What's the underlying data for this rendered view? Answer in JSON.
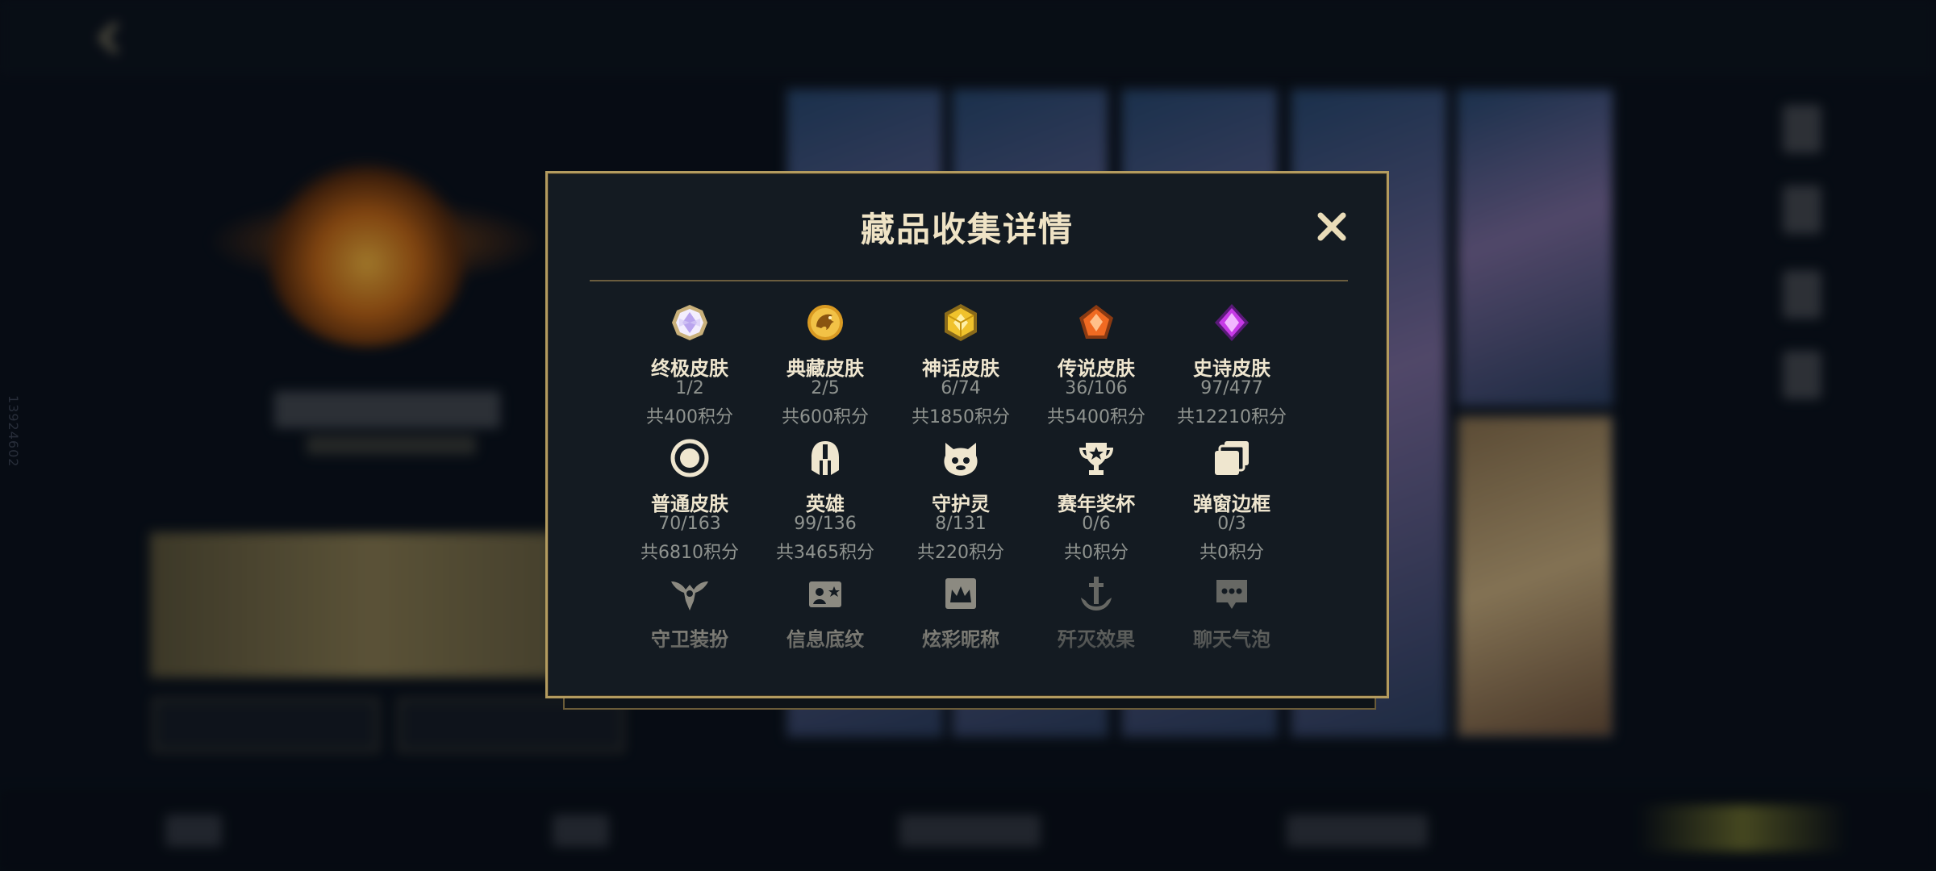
{
  "background": {
    "back_label": "",
    "vertical_id": "13924602"
  },
  "modal": {
    "title": "藏品收集详情",
    "close_icon": "close-x-icon",
    "accent_color": "#b39b5f",
    "items": [
      {
        "name": "终极皮肤",
        "progress": "1/2",
        "points": "共400积分",
        "icon": "ultimate-skin-gem-icon"
      },
      {
        "name": "典藏皮肤",
        "progress": "2/5",
        "points": "共600积分",
        "icon": "collection-skin-dragon-icon"
      },
      {
        "name": "神话皮肤",
        "progress": "6/74",
        "points": "共1850积分",
        "icon": "mythic-skin-gem-icon"
      },
      {
        "name": "传说皮肤",
        "progress": "36/106",
        "points": "共5400积分",
        "icon": "legendary-skin-gem-icon"
      },
      {
        "name": "史诗皮肤",
        "progress": "97/477",
        "points": "共12210积分",
        "icon": "epic-skin-gem-icon"
      },
      {
        "name": "普通皮肤",
        "progress": "70/163",
        "points": "共6810积分",
        "icon": "common-skin-ring-icon"
      },
      {
        "name": "英雄",
        "progress": "99/136",
        "points": "共3465积分",
        "icon": "hero-helmet-icon"
      },
      {
        "name": "守护灵",
        "progress": "8/131",
        "points": "共220积分",
        "icon": "guardian-spirit-icon"
      },
      {
        "name": "赛年奖杯",
        "progress": "0/6",
        "points": "共0积分",
        "icon": "trophy-icon"
      },
      {
        "name": "弹窗边框",
        "progress": "0/3",
        "points": "共0积分",
        "icon": "popup-frame-icon"
      },
      {
        "name": "守卫装扮",
        "icon": "ward-skin-icon"
      },
      {
        "name": "信息底纹",
        "icon": "info-pattern-icon"
      },
      {
        "name": "炫彩昵称",
        "icon": "colorful-nickname-icon"
      },
      {
        "name": "歼灭效果",
        "icon": "ace-effect-icon"
      },
      {
        "name": "聊天气泡",
        "icon": "chat-bubble-icon"
      }
    ]
  }
}
